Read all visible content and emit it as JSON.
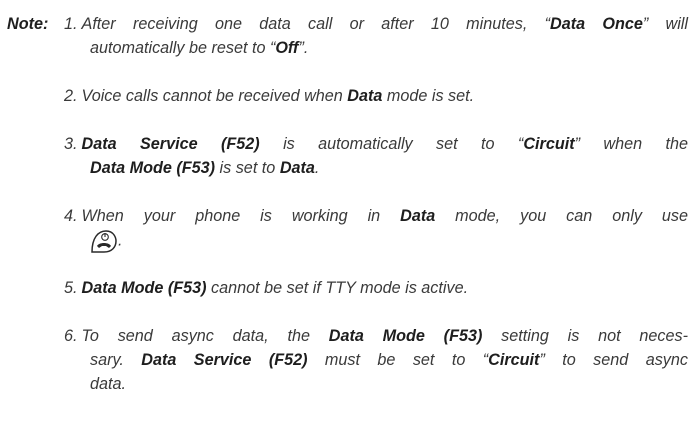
{
  "note": {
    "label": "Note:",
    "items": [
      {
        "num": "1.",
        "lines": [
          [
            {
              "t": "After receiving one data call or after 10 minutes, “",
              "b": false
            },
            {
              "t": "Data Once",
              "b": true
            },
            {
              "t": "” will",
              "b": false
            }
          ],
          [
            {
              "t": "automatically be reset to “",
              "b": false
            },
            {
              "t": "Off",
              "b": true
            },
            {
              "t": "”.",
              "b": false
            }
          ]
        ]
      },
      {
        "num": "2.",
        "lines": [
          [
            {
              "t": "Voice calls cannot be received when ",
              "b": false
            },
            {
              "t": "Data",
              "b": true
            },
            {
              "t": " mode is set.",
              "b": false
            }
          ]
        ]
      },
      {
        "num": "3.",
        "lines": [
          [
            {
              "t": "Data Service (F52)",
              "b": true
            },
            {
              "t": " is automatically set to “",
              "b": false
            },
            {
              "t": "Circuit",
              "b": true
            },
            {
              "t": "” when the",
              "b": false
            }
          ],
          [
            {
              "t": "Data Mode (F53)",
              "b": true
            },
            {
              "t": " is set to ",
              "b": false
            },
            {
              "t": "Data",
              "b": true
            },
            {
              "t": ".",
              "b": false
            }
          ]
        ]
      },
      {
        "num": "4.",
        "lines": [
          [
            {
              "t": "When your phone is working in ",
              "b": false
            },
            {
              "t": "Data",
              "b": true
            },
            {
              "t": " mode, you can only use",
              "b": false
            }
          ],
          [
            {
              "icon": "end-call-power-key-icon"
            },
            {
              "t": ".",
              "b": false
            }
          ]
        ]
      },
      {
        "num": "5.",
        "lines": [
          [
            {
              "t": "Data Mode (F53)",
              "b": true
            },
            {
              "t": " cannot be set if TTY mode is active.",
              "b": false
            }
          ]
        ]
      },
      {
        "num": "6.",
        "lines": [
          [
            {
              "t": "To send async data, the ",
              "b": false
            },
            {
              "t": "Data Mode (F53)",
              "b": true
            },
            {
              "t": " setting is not neces-",
              "b": false
            }
          ],
          [
            {
              "t": "sary. ",
              "b": false
            },
            {
              "t": "Data Service (F52)",
              "b": true
            },
            {
              "t": " must be set to “",
              "b": false
            },
            {
              "t": "Circuit",
              "b": true
            },
            {
              "t": "” to send async",
              "b": false
            }
          ],
          [
            {
              "t": "data",
              "b": false
            },
            {
              "t": ".",
              "b": false
            }
          ]
        ]
      }
    ]
  }
}
